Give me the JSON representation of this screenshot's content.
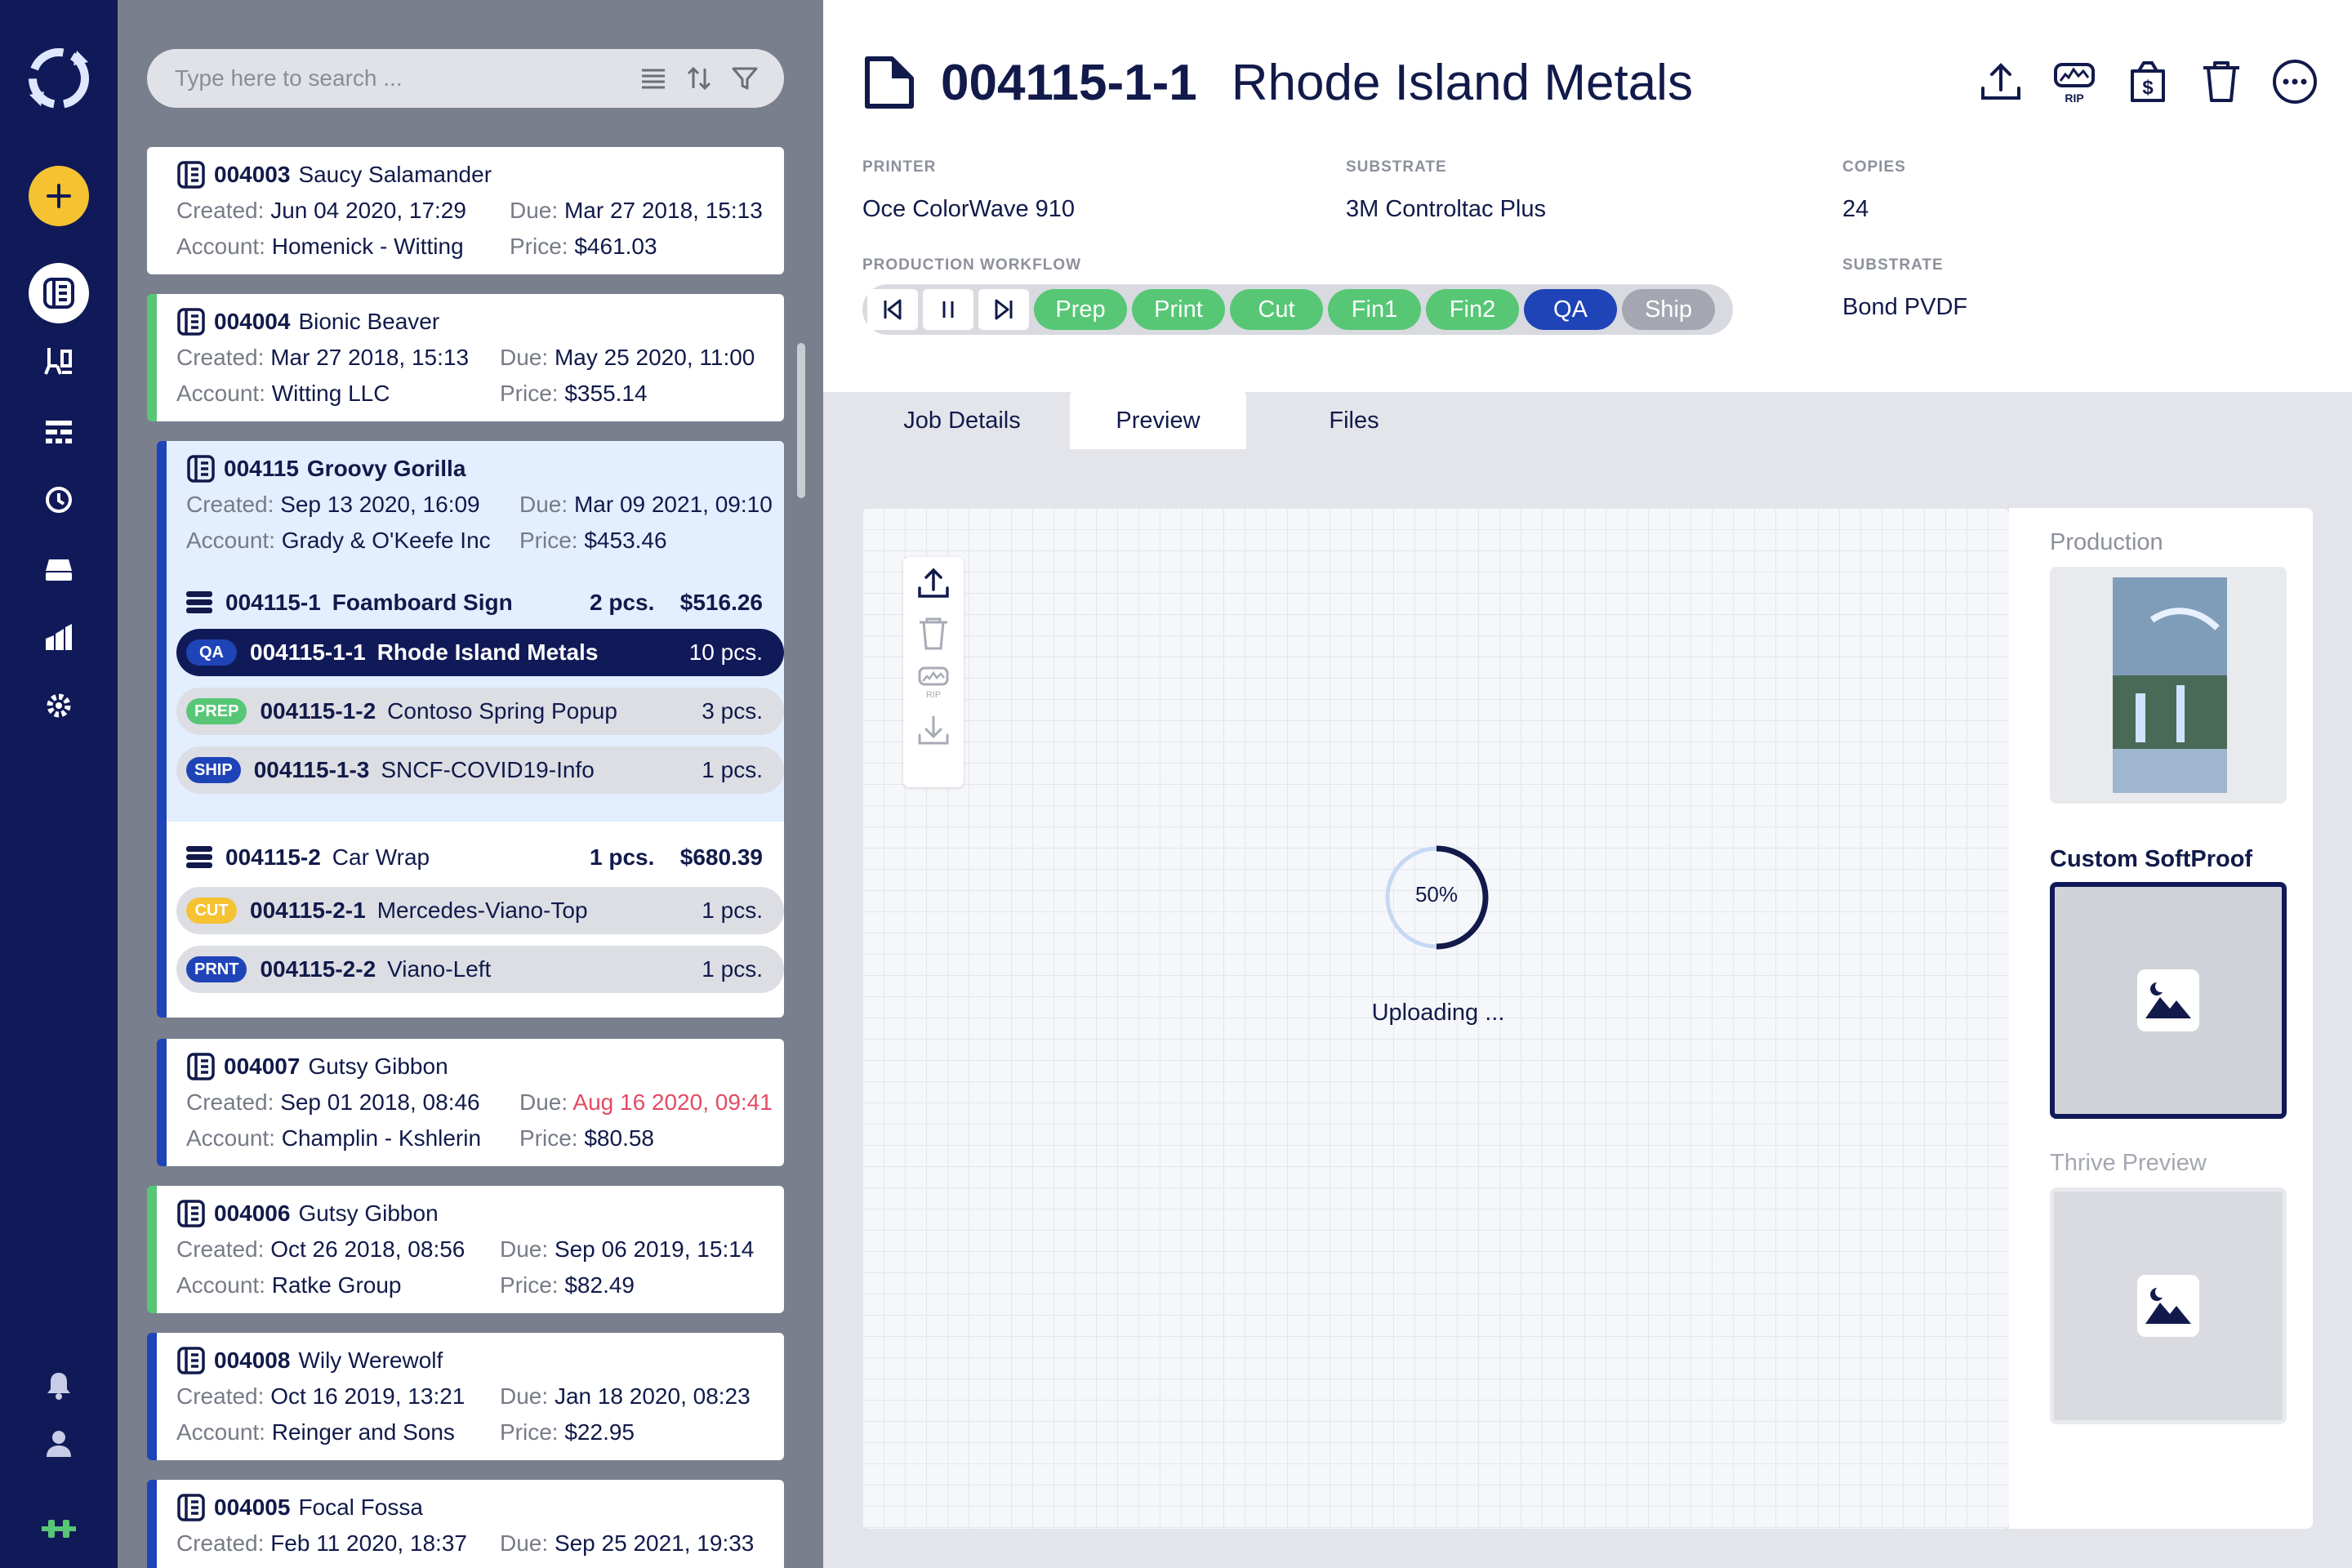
{
  "colors": {
    "rail": "#111a58",
    "accent_yellow": "#f5c232",
    "green": "#57c776",
    "blue": "#1f44b8",
    "navy": "#111a58",
    "grey": "#a4a7b1",
    "due_late": "#e24b63"
  },
  "search": {
    "placeholder": "Type here to search ..."
  },
  "nav": {
    "icons": [
      "refresh-logo-icon",
      "plus-icon",
      "jobs-icon",
      "printer-icon",
      "dashboard-icon",
      "history-icon",
      "storage-icon",
      "reports-icon",
      "settings-icon",
      "bell-icon",
      "user-icon",
      "plugin-icon"
    ]
  },
  "labels": {
    "created": "Created:",
    "due": "Due:",
    "account": "Account:",
    "price": "Price:"
  },
  "jobs": [
    {
      "num": "004003",
      "name": "Saucy Salamander",
      "created": "Jun 04 2020, 17:29",
      "due": "Mar 27 2018, 15:13",
      "account": "Homenick - Witting",
      "price": "$461.03"
    },
    {
      "num": "004004",
      "name": "Bionic Beaver",
      "created": "Mar 27 2018, 15:13",
      "due": "May 25 2020, 11:00",
      "account": "Witting LLC",
      "price": "$355.14"
    },
    {
      "num": "004115",
      "name": "Groovy Gorilla",
      "created": "Sep 13 2020, 16:09",
      "due": "Mar 09 2021, 09:10",
      "account": "Grady & O'Keefe Inc",
      "price": "$453.46"
    },
    {
      "num": "004007",
      "name": "Gutsy Gibbon",
      "created": "Sep 01 2018, 08:46",
      "due": "Aug 16 2020, 09:41",
      "account": "Champlin - Kshlerin",
      "price": "$80.58"
    },
    {
      "num": "004006",
      "name": "Gutsy Gibbon",
      "created": "Oct 26 2018, 08:56",
      "due": "Sep 06 2019, 15:14",
      "account": "Ratke Group",
      "price": "$82.49"
    },
    {
      "num": "004008",
      "name": "Wily Werewolf",
      "created": "Oct 16 2019, 13:21",
      "due": "Jan 18 2020, 08:23",
      "account": "Reinger and Sons",
      "price": "$22.95"
    },
    {
      "num": "004005",
      "name": "Focal Fossa",
      "created": "Feb 11 2020, 18:37",
      "due": "Sep 25 2021, 19:33"
    }
  ],
  "subjobs": [
    {
      "num": "004115-1",
      "name": "Foamboard Sign",
      "qty": "2 pcs.",
      "price": "$516.26",
      "items": [
        {
          "badge": "QA",
          "num": "004115-1-1",
          "name": "Rhode Island Metals",
          "qty": "10 pcs."
        },
        {
          "badge": "PREP",
          "num": "004115-1-2",
          "name": "Contoso Spring Popup",
          "qty": "3 pcs."
        },
        {
          "badge": "SHIP",
          "num": "004115-1-3",
          "name": "SNCF-COVID19-Info",
          "qty": "1 pcs."
        }
      ]
    },
    {
      "num": "004115-2",
      "name": "Car Wrap",
      "qty": "1 pcs.",
      "price": "$680.39",
      "items": [
        {
          "badge": "CUT",
          "num": "004115-2-1",
          "name": "Mercedes-Viano-Top",
          "qty": "1 pcs."
        },
        {
          "badge": "PRNT",
          "num": "004115-2-2",
          "name": "Viano-Left",
          "qty": "1 pcs."
        }
      ]
    }
  ],
  "detail": {
    "id": "004115-1-1",
    "name": "Rhode Island Metals",
    "printer_label": "PRINTER",
    "printer": "Oce ColorWave 910",
    "substrate_label": "SUBSTRATE",
    "substrate": "3M Controltac Plus",
    "copies_label": "COPIES",
    "copies": "24",
    "workflow_label": "PRODUCTION WORKFLOW",
    "substrate2_label": "SUBSTRATE",
    "substrate2": "Bond PVDF",
    "workflow": [
      "Prep",
      "Print",
      "Cut",
      "Fin1",
      "Fin2",
      "QA",
      "Ship"
    ],
    "rip_text": "RIP"
  },
  "tabs": [
    "Job Details",
    "Preview",
    "Files"
  ],
  "preview": {
    "progress_pct": 50,
    "progress_label": "50%",
    "status": "Uploading ...",
    "production_label": "Production",
    "softproof_label": "Custom SoftProof",
    "thrive_label": "Thrive Preview"
  }
}
